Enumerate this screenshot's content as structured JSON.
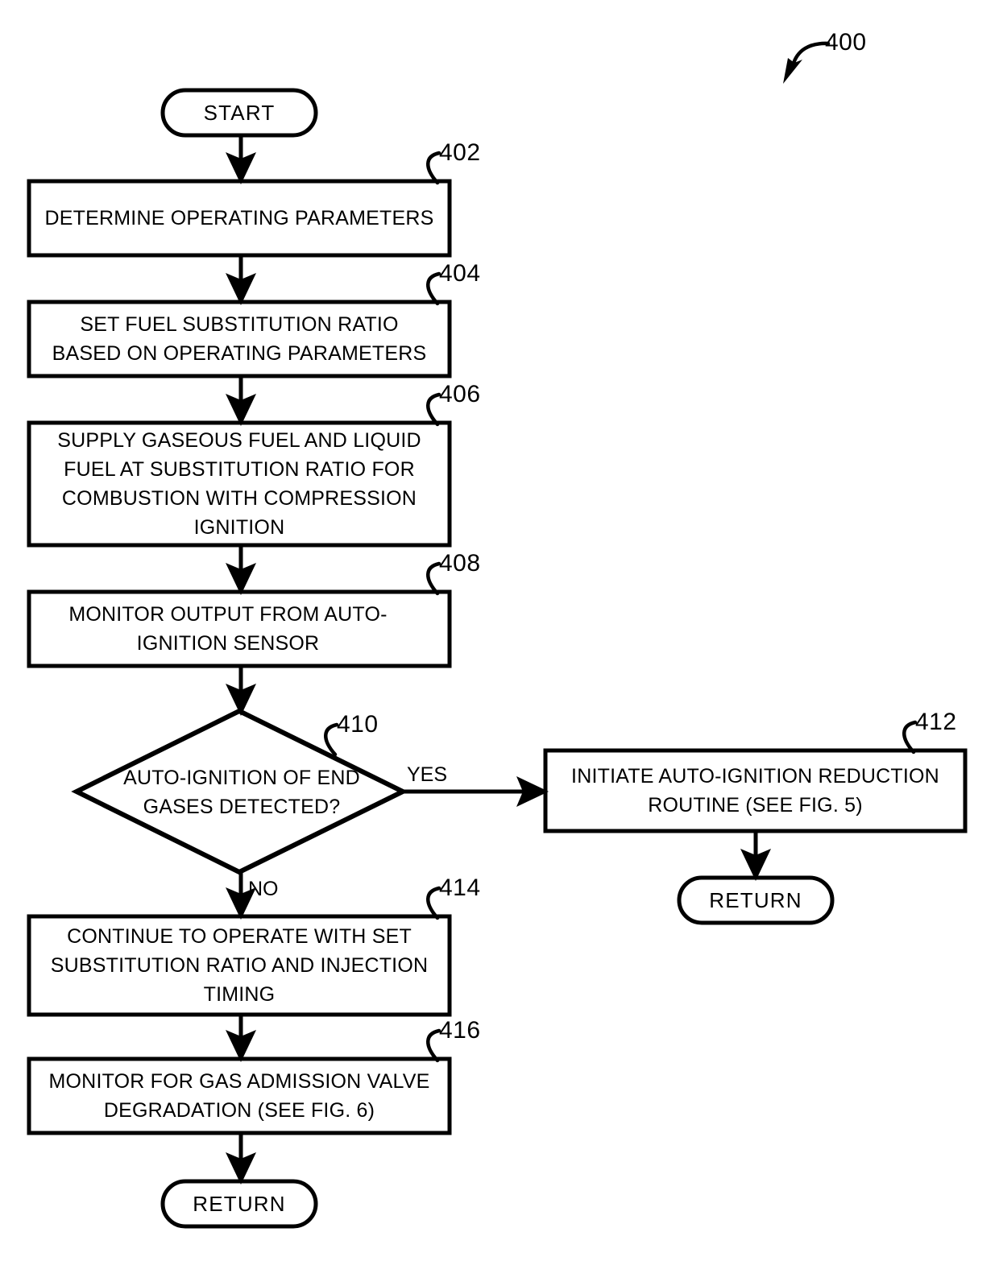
{
  "figure": {
    "reference_numeral": "400",
    "type": "patent-flowchart"
  },
  "nodes": {
    "start": {
      "label": "START",
      "shape": "terminator"
    },
    "step_402": {
      "ref": "402",
      "label": "DETERMINE OPERATING PARAMETERS",
      "shape": "process"
    },
    "step_404": {
      "ref": "404",
      "label": "SET FUEL SUBSTITUTION RATIO\nBASED ON OPERATING PARAMETERS",
      "shape": "process"
    },
    "step_406": {
      "ref": "406",
      "label": "SUPPLY GASEOUS FUEL AND LIQUID\nFUEL AT SUBSTITUTION RATIO FOR\nCOMBUSTION WITH COMPRESSION\nIGNITION",
      "shape": "process"
    },
    "step_408": {
      "ref": "408",
      "label": "MONITOR OUTPUT FROM AUTO-\nIGNITION SENSOR",
      "shape": "process"
    },
    "decision_410": {
      "ref": "410",
      "label": "AUTO-IGNITION OF END\nGASES DETECTED?",
      "shape": "decision"
    },
    "step_412": {
      "ref": "412",
      "label": "INITIATE AUTO-IGNITION REDUCTION\nROUTINE (SEE FIG. 5)",
      "shape": "process"
    },
    "step_414": {
      "ref": "414",
      "label": "CONTINUE TO OPERATE WITH SET\nSUBSTITUTION RATIO AND INJECTION\nTIMING",
      "shape": "process"
    },
    "step_416": {
      "ref": "416",
      "label": "MONITOR FOR GAS ADMISSION VALVE\nDEGRADATION (SEE FIG. 6)",
      "shape": "process"
    },
    "return_right": {
      "label": "RETURN",
      "shape": "terminator"
    },
    "return_bottom": {
      "label": "RETURN",
      "shape": "terminator"
    }
  },
  "branch_labels": {
    "yes": "YES",
    "no": "NO"
  },
  "colors": {
    "stroke": "#000000",
    "fill": "#ffffff",
    "text": "#000000"
  }
}
